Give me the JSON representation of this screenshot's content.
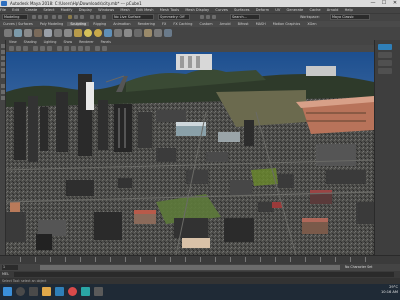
{
  "window": {
    "title": "Autodesk Maya 2018: C:\\Users\\Hp\\Downloads\\city.mb* --- pCube1",
    "minimize": "—",
    "maximize": "☐",
    "close": "✕"
  },
  "menubar": [
    "File",
    "Edit",
    "Create",
    "Select",
    "Modify",
    "Display",
    "Windows",
    "Mesh",
    "Edit Mesh",
    "Mesh Tools",
    "Mesh Display",
    "Curves",
    "Surfaces",
    "Deform",
    "UV",
    "Generate",
    "Cache",
    "Arnold",
    "Help"
  ],
  "statusline": {
    "mode": "Modeling",
    "workspace_label": "Workspace:",
    "workspace": "Maya Classic",
    "live": "No Live Surface",
    "symmetry": "Symmetry: Off",
    "search_placeholder": "Search..."
  },
  "shelf_tabs": [
    "Curves / Surfaces",
    "Poly Modeling",
    "Sculpting",
    "Rigging",
    "Animation",
    "Rendering",
    "FX",
    "FX Caching",
    "Custom",
    "Arnold",
    "Bifrost",
    "MASH",
    "Motion Graphics",
    "XGen"
  ],
  "shelf_active": "Sculpting",
  "panel_menu": [
    "View",
    "Shading",
    "Lighting",
    "Show",
    "Renderer",
    "Panels"
  ],
  "timeslider": {
    "ticks": [
      "5",
      "10",
      "15",
      "20",
      "25",
      "30",
      "35",
      "40",
      "45",
      "50",
      "55",
      "60",
      "65",
      "70",
      "75",
      "80",
      "85",
      "90",
      "95",
      "100",
      "105",
      "110",
      "115",
      "120"
    ]
  },
  "range": {
    "start": "1",
    "end": "120",
    "char_set": "No Character Set",
    "anim_layer": "No Anim Layer",
    "fps": "24 fps"
  },
  "cmdline": {
    "lang": "MEL",
    "text": ""
  },
  "helpline": "Select Tool: select an object",
  "taskbar": {
    "weather": "29°C",
    "time": "10:16 AM",
    "date": "11/23/2022"
  },
  "colors": {
    "sky_top": "#1d4f8f",
    "sky_bottom": "#6a8fc0",
    "ground": "#4a4a48",
    "accent_maya": "#2f7fb8"
  }
}
